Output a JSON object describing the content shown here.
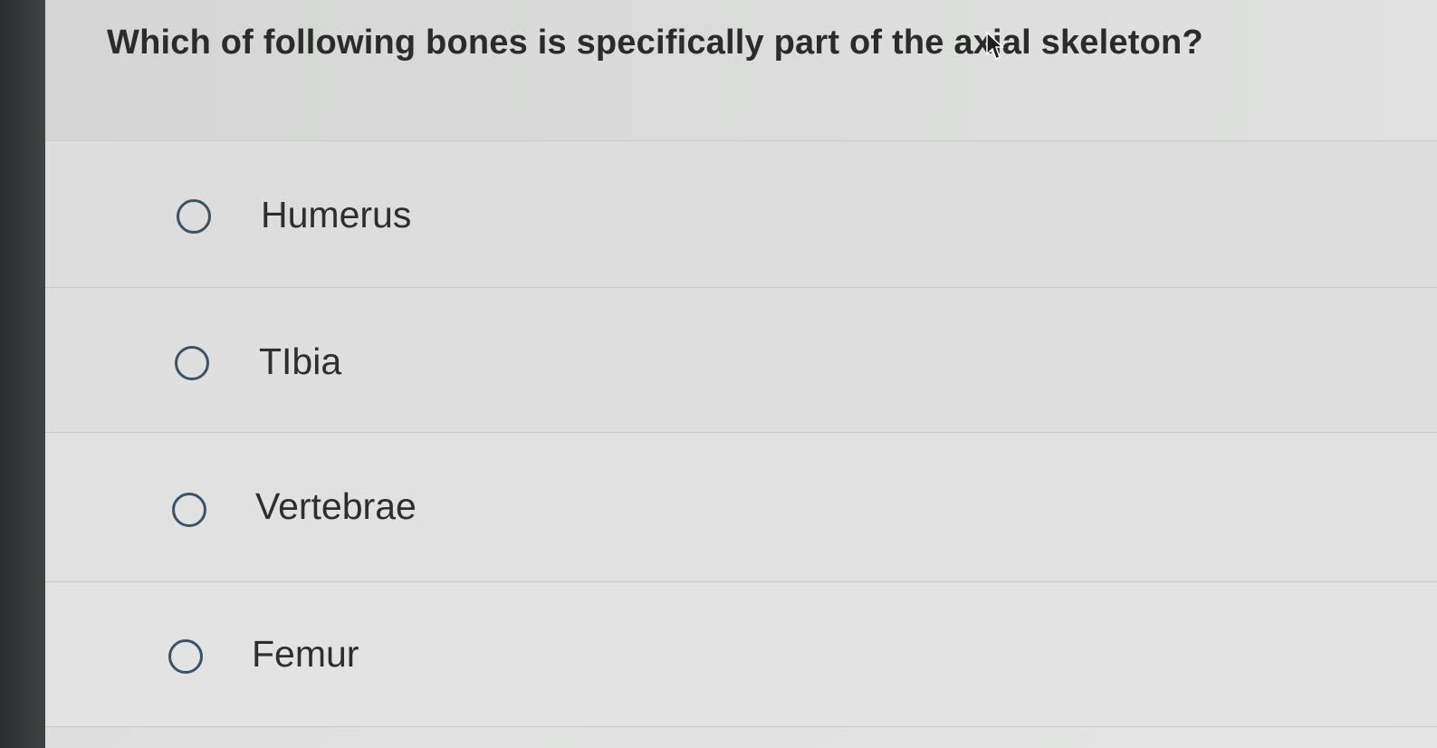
{
  "question": {
    "text": "Which of following bones is specifically part of the axial skeleton?"
  },
  "options": [
    {
      "label": "Humerus"
    },
    {
      "label": "TIbia"
    },
    {
      "label": "Vertebrae"
    },
    {
      "label": "Femur"
    }
  ],
  "colors": {
    "radio_border": "#3b5265",
    "text": "#2e2e2e",
    "background": "#dfe0df"
  },
  "icons": {
    "cursor": "arrow-cursor-icon",
    "radio": "radio-unchecked-icon"
  }
}
